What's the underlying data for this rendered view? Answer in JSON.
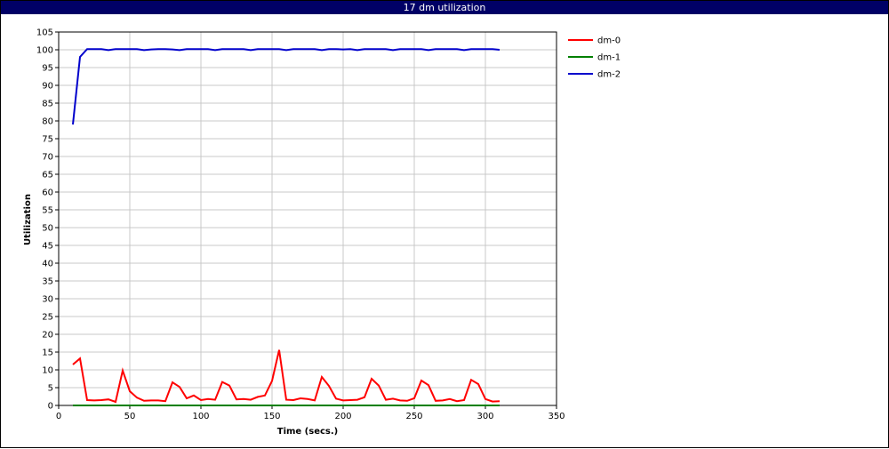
{
  "window": {
    "title": "17 dm utilization"
  },
  "chart_data": {
    "type": "line",
    "title": "17 dm utilization",
    "xlabel": "Time (secs.)",
    "ylabel": "Utilization",
    "xlim": [
      0,
      350
    ],
    "ylim": [
      0,
      105
    ],
    "xticks": [
      0,
      50,
      100,
      150,
      200,
      250,
      300,
      350
    ],
    "yticks": [
      0,
      5,
      10,
      15,
      20,
      25,
      30,
      35,
      40,
      45,
      50,
      55,
      60,
      65,
      70,
      75,
      80,
      85,
      90,
      95,
      100,
      105
    ],
    "grid": true,
    "legend_position": "right",
    "x": [
      10,
      15,
      20,
      25,
      30,
      35,
      40,
      45,
      50,
      55,
      60,
      65,
      70,
      75,
      80,
      85,
      90,
      95,
      100,
      105,
      110,
      115,
      120,
      125,
      130,
      135,
      140,
      145,
      150,
      155,
      160,
      165,
      170,
      175,
      180,
      185,
      190,
      195,
      200,
      205,
      210,
      215,
      220,
      225,
      230,
      235,
      240,
      245,
      250,
      255,
      260,
      265,
      270,
      275,
      280,
      285,
      290,
      295,
      300,
      305,
      310
    ],
    "series": [
      {
        "name": "dm-0",
        "color": "#ff0000",
        "values": [
          11.5,
          13.2,
          1.5,
          1.4,
          1.5,
          1.7,
          1.0,
          9.8,
          4.0,
          2.2,
          1.3,
          1.4,
          1.4,
          1.2,
          6.5,
          5.2,
          2.0,
          2.8,
          1.5,
          1.8,
          1.6,
          6.6,
          5.6,
          1.7,
          1.8,
          1.6,
          2.4,
          2.8,
          6.9,
          15.6,
          1.6,
          1.5,
          2.0,
          1.8,
          1.4,
          8.0,
          5.5,
          1.9,
          1.4,
          1.5,
          1.6,
          2.3,
          7.5,
          5.6,
          1.6,
          1.9,
          1.4,
          1.3,
          2.0,
          7.0,
          5.7,
          1.3,
          1.4,
          1.8,
          1.2,
          1.5,
          7.2,
          6.0,
          1.8,
          1.1,
          1.2
        ]
      },
      {
        "name": "dm-1",
        "color": "#008000",
        "values": [
          0,
          0,
          0,
          0,
          0,
          0,
          0,
          0,
          0,
          0,
          0,
          0,
          0,
          0,
          0,
          0,
          0,
          0,
          0,
          0,
          0,
          0,
          0,
          0,
          0,
          0,
          0,
          0,
          0,
          0,
          0,
          0,
          0,
          0,
          0,
          0,
          0,
          0,
          0,
          0,
          0,
          0,
          0,
          0,
          0,
          0,
          0,
          0,
          0,
          0,
          0,
          0,
          0,
          0,
          0,
          0,
          0,
          0,
          0,
          0,
          0
        ]
      },
      {
        "name": "dm-2",
        "color": "#0000cc",
        "values": [
          79.0,
          98.0,
          100.2,
          100.2,
          100.2,
          99.9,
          100.2,
          100.2,
          100.2,
          100.2,
          99.9,
          100.1,
          100.2,
          100.2,
          100.1,
          99.9,
          100.2,
          100.2,
          100.2,
          100.2,
          99.9,
          100.2,
          100.2,
          100.2,
          100.2,
          99.9,
          100.2,
          100.2,
          100.2,
          100.2,
          99.9,
          100.2,
          100.2,
          100.2,
          100.2,
          99.9,
          100.2,
          100.2,
          100.1,
          100.2,
          99.9,
          100.2,
          100.2,
          100.2,
          100.2,
          99.9,
          100.2,
          100.2,
          100.2,
          100.2,
          99.9,
          100.2,
          100.2,
          100.2,
          100.2,
          99.9,
          100.2,
          100.2,
          100.2,
          100.2,
          100.0
        ]
      }
    ]
  }
}
